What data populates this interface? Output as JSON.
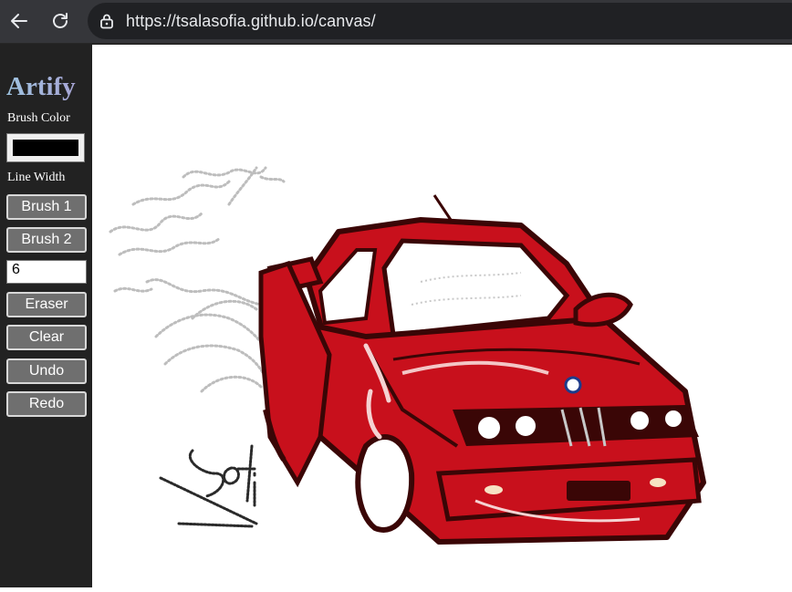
{
  "browser": {
    "url": "https://tsalasofia.github.io/canvas/"
  },
  "sidebar": {
    "title": "Artify",
    "brush_color_label": "Brush Color",
    "brush_color_value": "#000000",
    "line_width_label": "Line Width",
    "brush1_label": "Brush 1",
    "brush2_label": "Brush 2",
    "line_width_value": "6",
    "eraser_label": "Eraser",
    "clear_label": "Clear",
    "undo_label": "Undo",
    "redo_label": "Redo"
  },
  "canvas": {
    "drawing": "red car sketch",
    "signature": "Sofi",
    "colors": {
      "car": "#c8101c",
      "outline": "#3a0606",
      "smoke": "#b9b9b9"
    }
  }
}
